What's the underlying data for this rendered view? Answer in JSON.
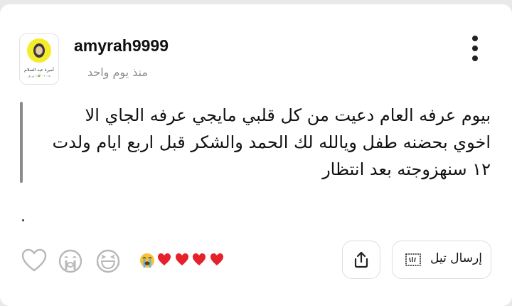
{
  "post": {
    "username": "amyrah9999",
    "time": "منذ يوم واحد",
    "avatar_caption": "أميرة عبد السلام 🍃",
    "avatar_subcaption": "٢٠١٥ - ٢٠٢٠ وردي",
    "body_lines": [
      "بيوم عرفه العام دعيت من كل قلبي مايجي عرفه الجاي الا",
      "اخوي بحضنه طفل ويالله لك الحمد والشكر قبل اربع ايام ولدت",
      "١٢ سنهزوجته بعد انتظار"
    ],
    "trailing_dot": "."
  },
  "reactions": {
    "icons": [
      "heart-outline-icon",
      "crying-face-outline-icon",
      "laughing-face-outline-icon"
    ],
    "emoji_summary": [
      "😭",
      "❤️",
      "❤️",
      "❤️",
      "❤️"
    ]
  },
  "actions": {
    "share_icon": "share-icon",
    "send_label": "إرسال تيل",
    "send_icon": "tell-card-icon"
  }
}
